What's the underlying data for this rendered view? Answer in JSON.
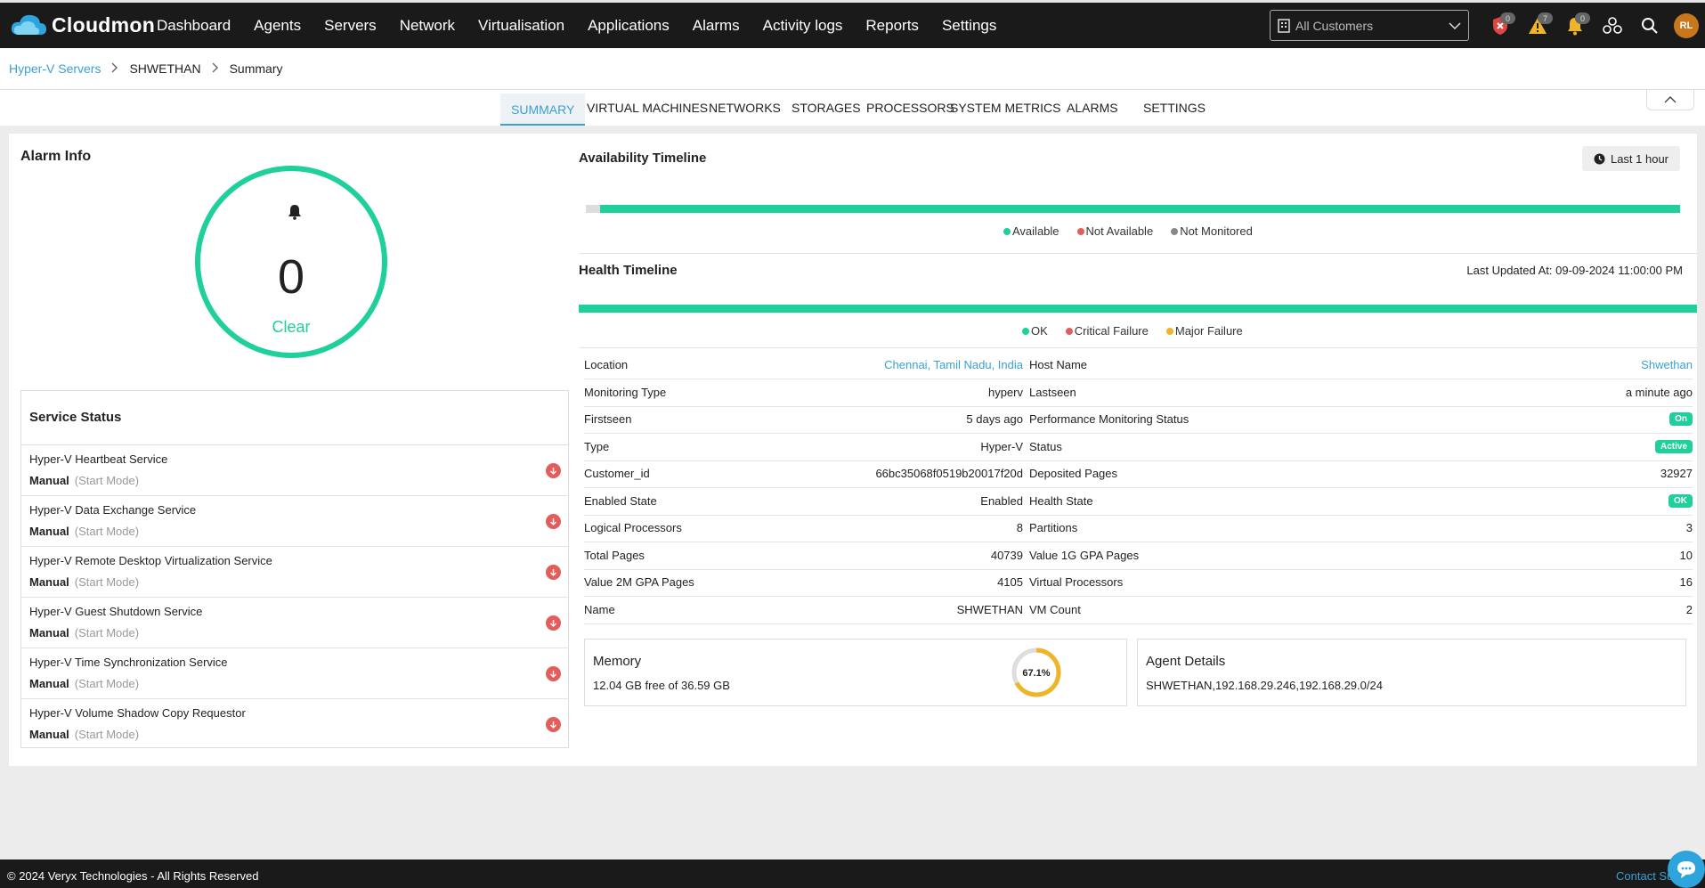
{
  "app": {
    "brand": "Cloudmon"
  },
  "nav": [
    {
      "label": "Dashboard"
    },
    {
      "label": "Agents"
    },
    {
      "label": "Servers"
    },
    {
      "label": "Network"
    },
    {
      "label": "Virtualisation"
    },
    {
      "label": "Applications"
    },
    {
      "label": "Alarms"
    },
    {
      "label": "Activity logs"
    },
    {
      "label": "Reports"
    },
    {
      "label": "Settings"
    }
  ],
  "customer_select": {
    "value": "All Customers"
  },
  "header_icons": {
    "badges": [
      "0",
      "7",
      "0"
    ],
    "avatar_initials": "RL"
  },
  "breadcrumb": {
    "root": "Hyper-V Servers",
    "server": "SHWETHAN",
    "current": "Summary"
  },
  "tabs": [
    {
      "label": "SUMMARY"
    },
    {
      "label": "VIRTUAL MACHINES"
    },
    {
      "label": "NETWORKS"
    },
    {
      "label": "STORAGES"
    },
    {
      "label": "PROCESSORS"
    },
    {
      "label": "SYSTEM METRICS"
    },
    {
      "label": "ALARMS"
    },
    {
      "label": "SETTINGS"
    }
  ],
  "alarm_info": {
    "title": "Alarm Info",
    "count": "0",
    "state": "Clear"
  },
  "service_status": {
    "title": "Service Status",
    "items": [
      {
        "name": "Hyper-V Heartbeat Service",
        "mode": "Manual",
        "mode_label": "(Start Mode)"
      },
      {
        "name": "Hyper-V Data Exchange Service",
        "mode": "Manual",
        "mode_label": "(Start Mode)"
      },
      {
        "name": "Hyper-V Remote Desktop Virtualization Service",
        "mode": "Manual",
        "mode_label": "(Start Mode)"
      },
      {
        "name": "Hyper-V Guest Shutdown Service",
        "mode": "Manual",
        "mode_label": "(Start Mode)"
      },
      {
        "name": "Hyper-V Time Synchronization Service",
        "mode": "Manual",
        "mode_label": "(Start Mode)"
      },
      {
        "name": "Hyper-V Volume Shadow Copy Requestor",
        "mode": "Manual",
        "mode_label": "(Start Mode)"
      }
    ]
  },
  "availability": {
    "title": "Availability Timeline",
    "range": "Last 1 hour",
    "legend": [
      "Available",
      "Not Available",
      "Not Monitored"
    ],
    "not_monitored_fraction": 0.013
  },
  "health": {
    "title": "Health Timeline",
    "updated": "Last Updated At: 09-09-2024 11:00:00 PM",
    "legend": [
      "OK",
      "Critical Failure",
      "Major Failure"
    ]
  },
  "details_left": [
    {
      "k": "Location",
      "v": "Chennai, Tamil Nadu, India"
    },
    {
      "k": "Monitoring Type",
      "v": "hyperv"
    },
    {
      "k": "Firstseen",
      "v": "5 days ago"
    },
    {
      "k": "Type",
      "v": "Hyper-V"
    },
    {
      "k": "Customer_id",
      "v": "66bc35068f0519b20017f20d"
    },
    {
      "k": "Enabled State",
      "v": "Enabled"
    },
    {
      "k": "Logical Processors",
      "v": "8"
    },
    {
      "k": "Total Pages",
      "v": "40739"
    },
    {
      "k": "Value 2M GPA Pages",
      "v": "4105"
    },
    {
      "k": "Name",
      "v": "SHWETHAN"
    }
  ],
  "details_right": [
    {
      "k": "Host Name",
      "v": "Shwethan"
    },
    {
      "k": "Lastseen",
      "v": "a minute ago"
    },
    {
      "k": "Performance Monitoring Status",
      "v": "On"
    },
    {
      "k": "Status",
      "v": "Active"
    },
    {
      "k": "Deposited Pages",
      "v": "32927"
    },
    {
      "k": "Health State",
      "v": "OK"
    },
    {
      "k": "Partitions",
      "v": "3"
    },
    {
      "k": "Value 1G GPA Pages",
      "v": "10"
    },
    {
      "k": "Virtual Processors",
      "v": "16"
    },
    {
      "k": "VM Count",
      "v": "2"
    }
  ],
  "memory": {
    "title": "Memory",
    "sub": "12.04 GB free of 36.59 GB",
    "percent_label": "67.1%",
    "percent": 67.1
  },
  "agent": {
    "title": "Agent Details",
    "sub": "SHWETHAN,192.168.29.246,192.168.29.0/24"
  },
  "footer": {
    "copy": "© 2024 Veryx Technologies - All Rights Reserved",
    "contact": "Contact Support"
  },
  "colors": {
    "ok": "#1fcf9c",
    "critical": "#e45d5d",
    "major": "#f0b428",
    "not_monitored": "#888888",
    "link": "#3aa0d6"
  }
}
